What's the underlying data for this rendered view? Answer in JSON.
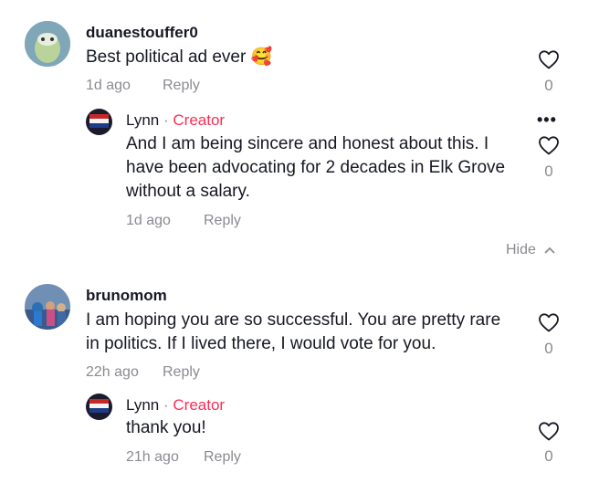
{
  "comments": [
    {
      "username": "duanestouffer0",
      "text": "Best political ad ever",
      "emoji": "🥰",
      "time": "1d ago",
      "reply_label": "Reply",
      "likes": "0",
      "replies": [
        {
          "username": "Lynn",
          "separator": "·",
          "badge": "Creator",
          "text": "And I am being sincere and honest about this. I have been advocating for 2 decades in Elk Grove without a salary.",
          "time": "1d ago",
          "reply_label": "Reply",
          "likes": "0",
          "more_label": "•••"
        }
      ],
      "hide_label": "Hide"
    },
    {
      "username": "brunomom",
      "text": "I am hoping you are so successful. You are pretty rare in politics. If I lived there, I would vote for you.",
      "time": "22h ago",
      "reply_label": "Reply",
      "likes": "0",
      "replies": [
        {
          "username": "Lynn",
          "separator": "·",
          "badge": "Creator",
          "text": "thank you!",
          "time": "21h ago",
          "reply_label": "Reply",
          "likes": "0"
        }
      ]
    }
  ],
  "colors": {
    "creator": "#fe2c55",
    "meta": "#8a8b91",
    "text": "#161823"
  },
  "icons": [
    "heart-outline-icon",
    "more-options-icon",
    "chevron-up-icon"
  ]
}
